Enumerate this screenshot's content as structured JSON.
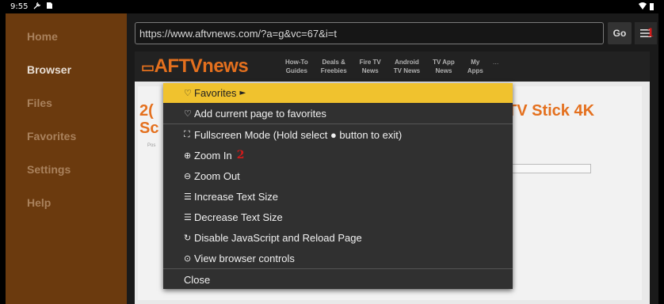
{
  "status_bar": {
    "time": "9:55",
    "left_icons": [
      "settings-icon",
      "sd-card-icon"
    ],
    "right_icons": [
      "wifi-icon",
      "battery-icon"
    ]
  },
  "sidebar": {
    "items": [
      {
        "label": "Home",
        "active": false
      },
      {
        "label": "Browser",
        "active": true
      },
      {
        "label": "Files",
        "active": false
      },
      {
        "label": "Favorites",
        "active": false
      },
      {
        "label": "Settings",
        "active": false
      },
      {
        "label": "Help",
        "active": false
      }
    ]
  },
  "toolbar": {
    "url": "https://www.aftvnews.com/?a=g&vc=67&i=t",
    "go_label": "Go",
    "menu_icon": "hamburger-menu-icon",
    "annotation_1": "1"
  },
  "website": {
    "logo": "AFTVnews",
    "nav": [
      {
        "line1": "How-To",
        "line2": "Guides"
      },
      {
        "line1": "Deals &",
        "line2": "Freebies"
      },
      {
        "line1": "Fire TV",
        "line2": "News"
      },
      {
        "line1": "Android",
        "line2": "TV News"
      },
      {
        "line1": "TV App",
        "line2": "News"
      },
      {
        "line1": "My",
        "line2": "Apps"
      }
    ],
    "nav_more": "...",
    "title_left_line1": "2(",
    "title_left_line2": "Sc",
    "title_right": "TV Stick 4K",
    "post_meta": "Pos"
  },
  "menu": {
    "items": [
      {
        "icon": "♡",
        "icon_name": "heart-icon",
        "label": "Favorites",
        "submenu_arrow": "►",
        "highlighted": true
      },
      {
        "icon": "♡",
        "icon_name": "heart-icon",
        "label": "Add current page to favorites"
      },
      {
        "icon": "⛶",
        "icon_name": "fullscreen-icon",
        "label": "Fullscreen Mode (Hold select ● button to exit)"
      },
      {
        "icon": "⊕",
        "icon_name": "zoom-in-icon",
        "label": "Zoom In",
        "annotation": "2"
      },
      {
        "icon": "⊖",
        "icon_name": "zoom-out-icon",
        "label": "Zoom Out"
      },
      {
        "icon": "☰",
        "icon_name": "increase-text-icon",
        "label": "Increase Text Size"
      },
      {
        "icon": "☰",
        "icon_name": "decrease-text-icon",
        "label": "Decrease Text Size"
      },
      {
        "icon": "↻",
        "icon_name": "reload-icon",
        "label": "Disable JavaScript and Reload Page"
      },
      {
        "icon": "⊙",
        "icon_name": "view-icon",
        "label": "View browser controls"
      },
      {
        "icon": "",
        "icon_name": "",
        "label": "Close"
      }
    ]
  },
  "colors": {
    "sidebar_bg": "#6b3a0e",
    "menu_bg": "#303030",
    "highlight": "#f0c22e",
    "brand_orange": "#e4701e",
    "annotation_red": "#d11a1a"
  }
}
